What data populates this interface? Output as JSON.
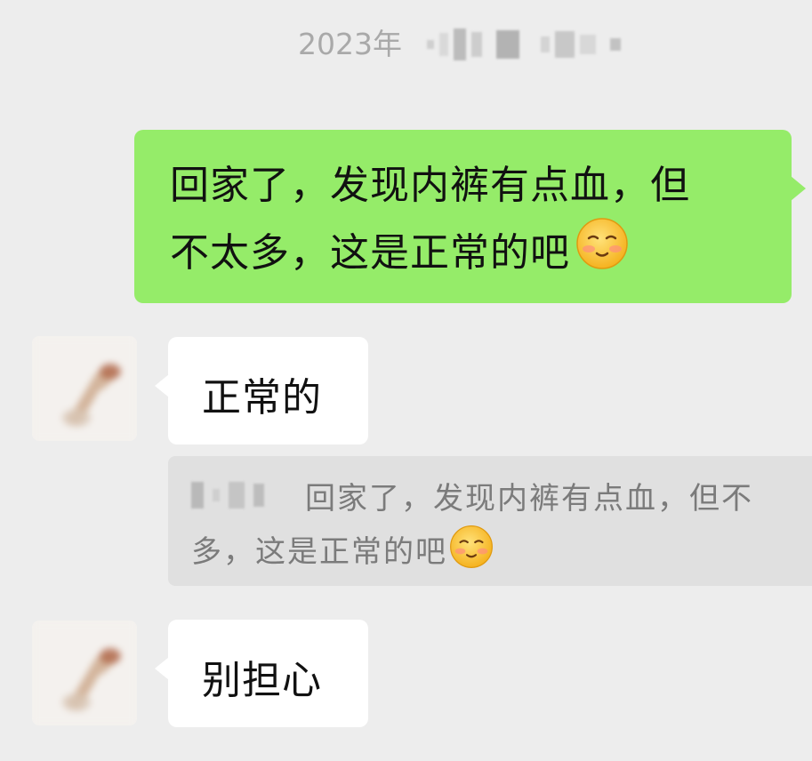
{
  "timestamp": {
    "year_label": "2023年"
  },
  "messages": [
    {
      "direction": "out",
      "text_line1": "回家了，发现内裤有点血，但",
      "text_line2": "不太多，这是正常的吧",
      "emoji": "shy-smile-emoji"
    },
    {
      "direction": "in",
      "text": "正常的"
    },
    {
      "direction": "quote",
      "line1": "回家了，发现内裤有点血，但不",
      "line2": "多，这是正常的吧",
      "emoji": "shy-smile-emoji"
    },
    {
      "direction": "in",
      "text": "别担心"
    }
  ],
  "colors": {
    "background": "#ededed",
    "outgoing_bubble": "#95ec69",
    "incoming_bubble": "#ffffff",
    "quote_background": "#e0e0e0",
    "timestamp_text": "#a9a9a9",
    "quote_text": "#7b7b7b"
  }
}
